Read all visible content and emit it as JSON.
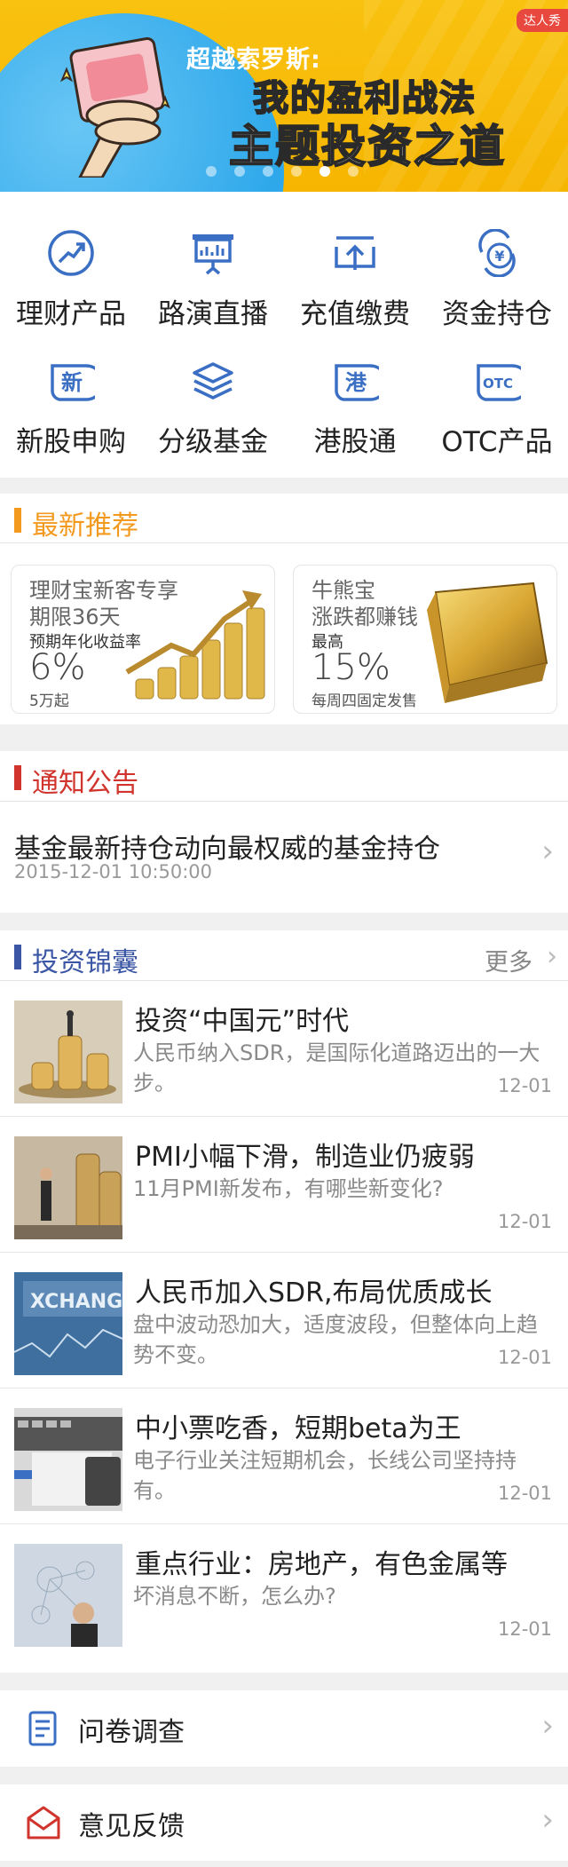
{
  "banner": {
    "badge": "达人秀",
    "line1": "超越索罗斯:",
    "line2": "我的盈利战法",
    "line3": "主题投资之道",
    "dots_total": 6,
    "active_dot": 5
  },
  "grid": [
    {
      "label": "理财产品",
      "icon": "trend-chart-icon"
    },
    {
      "label": "路演直播",
      "icon": "presentation-board-icon"
    },
    {
      "label": "充值缴费",
      "icon": "upload-tray-icon"
    },
    {
      "label": "资金持仓",
      "icon": "yen-exchange-icon"
    },
    {
      "label": "新股申购",
      "icon": "new-stock-icon",
      "glyph": "新"
    },
    {
      "label": "分级基金",
      "icon": "layers-icon"
    },
    {
      "label": "港股通",
      "icon": "hk-stock-icon",
      "glyph": "港"
    },
    {
      "label": "OTC产品",
      "icon": "otc-icon",
      "glyph": "OTC"
    }
  ],
  "recommend": {
    "title": "最新推荐",
    "cards": [
      {
        "line1": "理财宝新客专享",
        "line2": "期限36天",
        "rate_label": "预期年化收益率",
        "rate": "6%",
        "note": "5万起"
      },
      {
        "line1": "牛熊宝",
        "line2": "涨跌都赚钱",
        "rate_label": "最高",
        "rate": "15%",
        "note": "每周四固定发售"
      }
    ]
  },
  "notice": {
    "title": "通知公告",
    "item_title": "基金最新持仓动向最权威的基金持仓",
    "item_time": "2015-12-01 10:50:00"
  },
  "articles": {
    "title": "投资锦囊",
    "more": "更多",
    "items": [
      {
        "title": "投资“中国元”时代",
        "desc": "人民币纳入SDR，是国际化道路迈出的一大步。",
        "date": "12-01"
      },
      {
        "title": "PMI小幅下滑，制造业仍疲弱",
        "desc": "11月PMI新发布，有哪些新变化?",
        "date": "12-01"
      },
      {
        "title": "人民币加入SDR,布局优质成长",
        "desc": "盘中波动恐加大，适度波段，但整体向上趋势不变。",
        "date": "12-01"
      },
      {
        "title": "中小票吃香，短期beta为王",
        "desc": "电子行业关注短期机会，长线公司坚持持有。",
        "date": "12-01"
      },
      {
        "title": "重点行业：房地产，有色金属等",
        "desc": "坏消息不断，怎么办?",
        "date": "12-01"
      }
    ]
  },
  "links": [
    {
      "label": "问卷调查"
    },
    {
      "label": "意见反馈"
    }
  ],
  "colors": {
    "blue": "#3a6fc4",
    "orange": "#f39a1e",
    "red": "#d0342c",
    "navy": "#3a56a5"
  }
}
